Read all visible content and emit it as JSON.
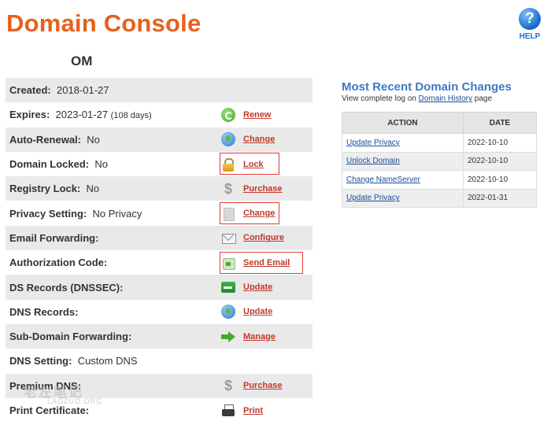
{
  "header": {
    "title": "Domain Console",
    "help_symbol": "?",
    "help_label": "HELP"
  },
  "domain_name": "OM",
  "settings": [
    {
      "label": "Created:",
      "value": "2018-01-27"
    },
    {
      "label": "Expires:",
      "value": "2023-01-27",
      "note": "(108 days)",
      "action": "Renew",
      "icon": "renew-icon"
    },
    {
      "label": "Auto-Renewal:",
      "value": "No",
      "action": "Change",
      "icon": "globe-icon"
    },
    {
      "label": "Domain Locked:",
      "value": "No",
      "action": "Lock",
      "icon": "lock-icon",
      "highlighted": true
    },
    {
      "label": "Registry Lock:",
      "value": "No",
      "action": "Purchase",
      "icon": "dollar-icon"
    },
    {
      "label": "Privacy Setting:",
      "value": "No Privacy",
      "action": "Change",
      "icon": "privacy-icon",
      "highlighted": true
    },
    {
      "label": "Email Forwarding:",
      "value": "",
      "action": "Configure",
      "icon": "mail-icon"
    },
    {
      "label": "Authorization Code:",
      "value": "",
      "action": "Send Email",
      "icon": "auth-code-icon",
      "highlighted": true
    },
    {
      "label": "DS Records (DNSSEC):",
      "value": "",
      "action": "Update",
      "icon": "key-icon"
    },
    {
      "label": "DNS Records:",
      "value": "",
      "action": "Update",
      "icon": "globe-icon"
    },
    {
      "label": "Sub-Domain Forwarding:",
      "value": "",
      "action": "Manage",
      "icon": "arrow-icon"
    },
    {
      "label": "DNS Setting:",
      "value": "Custom DNS"
    },
    {
      "label": "Premium DNS:",
      "value": "",
      "action": "Purchase",
      "icon": "dollar-icon"
    },
    {
      "label": "Print Certificate:",
      "value": "",
      "action": "Print",
      "icon": "printer-icon"
    }
  ],
  "recent_changes": {
    "title": "Most Recent Domain Changes",
    "subtitle_prefix": "View complete log on ",
    "subtitle_link": "Domain History",
    "subtitle_suffix": " page",
    "columns": [
      "ACTION",
      "DATE"
    ],
    "rows": [
      {
        "action": "Update Privacy",
        "date": "2022-10-10"
      },
      {
        "action": "Unlock Domain",
        "date": "2022-10-10"
      },
      {
        "action": "Change NameServer",
        "date": "2022-10-10"
      },
      {
        "action": "Update Privacy",
        "date": "2022-01-31"
      }
    ]
  },
  "watermark": {
    "text": "老左笔记",
    "subtext": "LAOZUO.ORG"
  },
  "colors": {
    "title": "#e8601c",
    "link": "#c0392b",
    "accent_blue": "#3d79c4",
    "highlight_box": "#e53935"
  }
}
